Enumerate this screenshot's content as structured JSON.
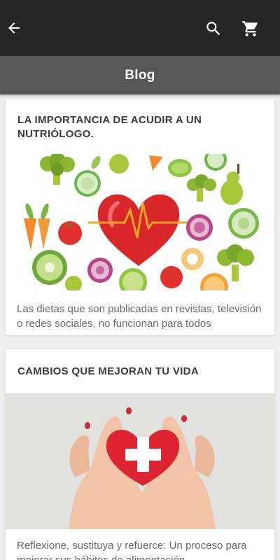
{
  "appbar": {
    "back_icon": "arrow-back-icon",
    "search_icon": "search-icon",
    "cart_icon": "shopping-cart-icon"
  },
  "subbar": {
    "title": "Blog"
  },
  "posts": [
    {
      "title": "LA IMPORTANCIA DE ACUDIR A UN NUTRIÓLOGO.",
      "image": "heart-vegetables-illustration",
      "excerpt": "Las dietas que son publicadas en revistas, televisión o redes sociales, no funcionan para todos"
    },
    {
      "title": "CAMBIOS QUE MEJORAN TU VIDA",
      "image": "hands-holding-heart-photo",
      "excerpt": "Reflexione, sustituya y refuerce: Un proceso para mejorar sus hábitos de alimentación"
    }
  ],
  "colors": {
    "appbar": "#262626",
    "subbar": "#575757",
    "background": "#eeeeee",
    "card": "#ffffff",
    "heart_red": "#d9262b"
  }
}
